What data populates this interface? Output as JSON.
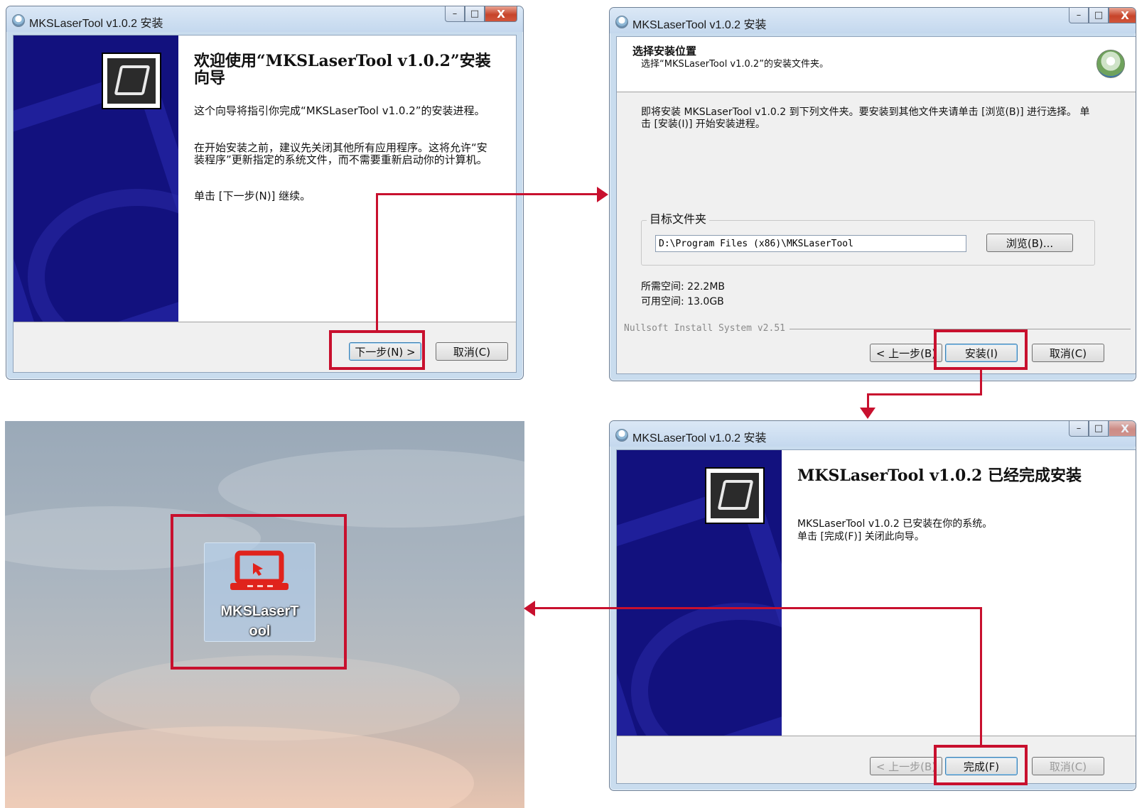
{
  "window_title": "MKSLaserTool v1.0.2 安装",
  "window_controls": {
    "minimize": "–",
    "maximize": "□",
    "close": "X"
  },
  "welcome": {
    "heading": "欢迎使用“MKSLaserTool v1.0.2”安装向导",
    "para1": "这个向导将指引你完成“MKSLaserTool v1.0.2”的安装进程。",
    "para2": "在开始安装之前，建议先关闭其他所有应用程序。这将允许“安装程序”更新指定的系统文件，而不需要重新启动你的计算机。",
    "para3": "单击 [下一步(N)] 继续。",
    "next_button": "下一步(N) >",
    "cancel_button": "取消(C)"
  },
  "choose_location": {
    "header_title": "选择安装位置",
    "header_subtitle": "选择“MKSLaserTool v1.0.2”的安装文件夹。",
    "description": "即将安装 MKSLaserTool v1.0.2 到下列文件夹。要安装到其他文件夹请单击 [浏览(B)] 进行选择。 单击 [安装(I)] 开始安装进程。",
    "group_label": "目标文件夹",
    "path_value": "D:\\Program Files (x86)\\MKSLaserTool",
    "browse_button": "浏览(B)...",
    "space_required": "所需空间: 22.2MB",
    "space_available": "可用空间: 13.0GB",
    "brand": "Nullsoft Install System v2.51",
    "back_button": "< 上一步(B)",
    "install_button": "安装(I)",
    "cancel_button": "取消(C)"
  },
  "finish": {
    "heading": "MKSLaserTool v1.0.2 已经完成安装",
    "line1": "MKSLaserTool v1.0.2 已安装在你的系统。",
    "line2": "单击 [完成(F)] 关闭此向导。",
    "back_button": "< 上一步(B)",
    "finish_button": "完成(F)",
    "cancel_button": "取消(C)"
  },
  "desktop": {
    "icon_label_line1": "MKSLaserT",
    "icon_label_line2": "ool"
  },
  "colors": {
    "highlight": "#c8102e",
    "banner": "#12117e",
    "icon_red": "#e0231c"
  },
  "icons": [
    "installer-icon",
    "computer-logo-icon",
    "install-disk-icon",
    "laptop-laser-icon"
  ]
}
